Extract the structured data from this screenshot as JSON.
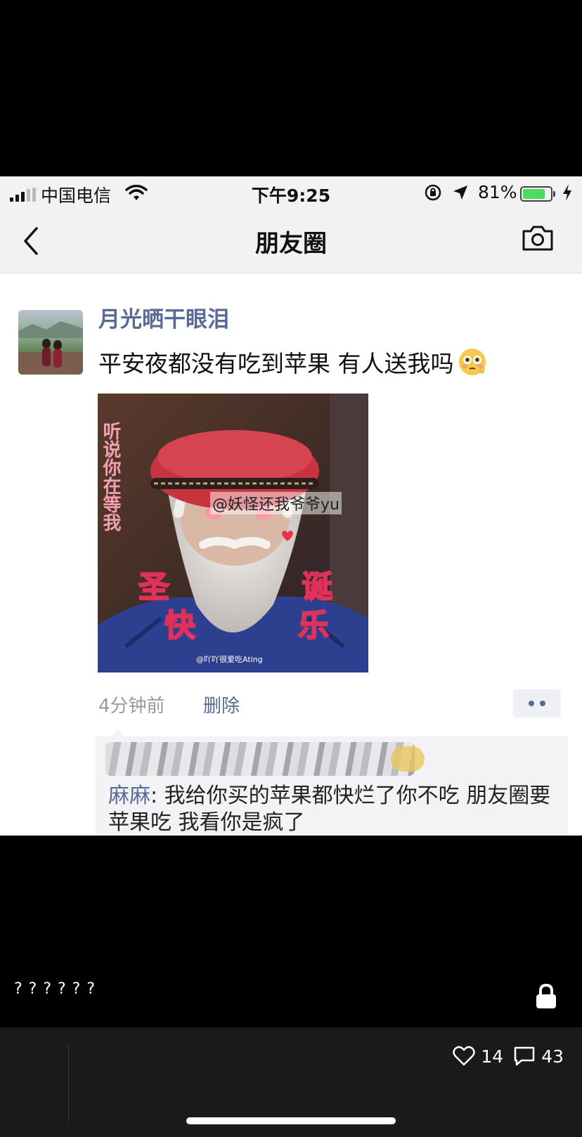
{
  "status_bar": {
    "carrier": "中国电信",
    "time": "下午9:25",
    "battery_percent": "81%",
    "battery_level": 0.81,
    "signal_bars": 3
  },
  "nav": {
    "title": "朋友圈",
    "back_icon": "chevron-left-icon",
    "camera_icon": "camera-icon"
  },
  "post": {
    "username": "月光晒干眼泪",
    "text": "平安夜都没有吃到苹果 有人送我吗",
    "image": {
      "side_text": "听说你在等我",
      "text_sheng": "圣",
      "text_dan": "诞",
      "text_kuai": "快",
      "text_le": "乐",
      "watermark_main": "@妖怪还我爷爷yu",
      "watermark_small": "@吖吖很爱吃Ating"
    },
    "time_ago": "4分钟前",
    "delete_label": "删除"
  },
  "comment": {
    "author": "麻麻",
    "separator": ": ",
    "text": "我给你买的苹果都快烂了你不吃 朋友圈要苹果吃 我看你是疯了"
  },
  "viewer": {
    "caption": "? ? ? ? ? ?",
    "like_count": "14",
    "comment_count": "43"
  },
  "colors": {
    "link_blue": "#576b95",
    "battery_green": "#4cd964"
  }
}
